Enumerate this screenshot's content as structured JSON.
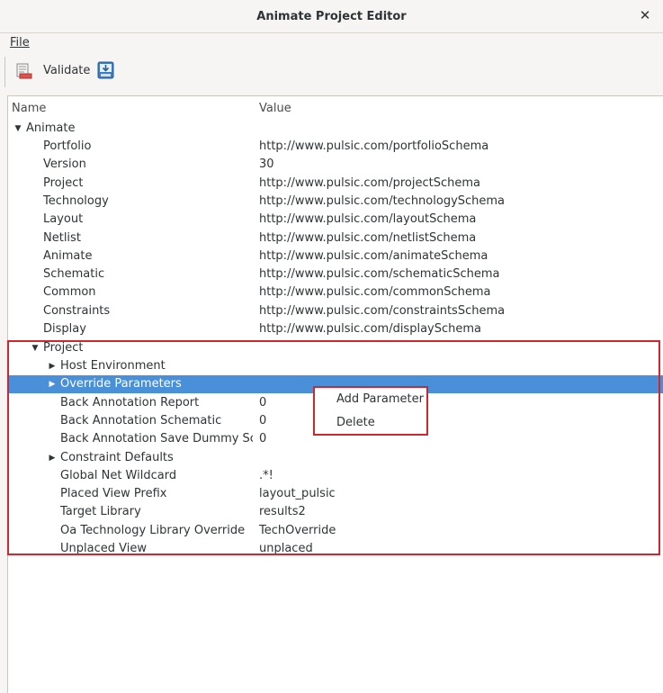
{
  "window": {
    "title": "Animate Project Editor"
  },
  "menubar": {
    "file_label": "File"
  },
  "toolbar": {
    "validate_label": "Validate"
  },
  "tree": {
    "columns": {
      "name": "Name",
      "value": "Value"
    },
    "root": "Animate",
    "schemas": [
      {
        "name": "Portfolio",
        "value": "http://www.pulsic.com/portfolioSchema"
      },
      {
        "name": "Version",
        "value": "30"
      },
      {
        "name": "Project",
        "value": "http://www.pulsic.com/projectSchema"
      },
      {
        "name": "Technology",
        "value": "http://www.pulsic.com/technologySchema"
      },
      {
        "name": "Layout",
        "value": "http://www.pulsic.com/layoutSchema"
      },
      {
        "name": "Netlist",
        "value": "http://www.pulsic.com/netlistSchema"
      },
      {
        "name": "Animate",
        "value": "http://www.pulsic.com/animateSchema"
      },
      {
        "name": "Schematic",
        "value": "http://www.pulsic.com/schematicSchema"
      },
      {
        "name": "Common",
        "value": "http://www.pulsic.com/commonSchema"
      },
      {
        "name": "Constraints",
        "value": "http://www.pulsic.com/constraintsSchema"
      },
      {
        "name": "Display",
        "value": "http://www.pulsic.com/displaySchema"
      }
    ],
    "project_label": "Project",
    "project_children": [
      {
        "name": "Host Environment",
        "value": "",
        "expander": true
      },
      {
        "name": "Override Parameters",
        "value": "",
        "expander": true,
        "selected": true
      },
      {
        "name": "Back Annotation Report",
        "value": "0"
      },
      {
        "name": "Back Annotation Schematic",
        "value": "0"
      },
      {
        "name": "Back Annotation Save Dummy Sch…",
        "value": "0"
      },
      {
        "name": "Constraint Defaults",
        "value": "",
        "expander": true
      },
      {
        "name": "Global Net Wildcard",
        "value": ".*!"
      },
      {
        "name": "Placed View Prefix",
        "value": "layout_pulsic"
      },
      {
        "name": "Target Library",
        "value": "results2"
      },
      {
        "name": "Oa Technology Library Override",
        "value": "TechOverride"
      },
      {
        "name": "Unplaced View",
        "value": "unplaced"
      }
    ]
  },
  "context_menu": {
    "add_parameter": "Add Parameter",
    "delete": "Delete"
  },
  "colors": {
    "selection": "#4a90d9",
    "highlight": "#d0262e"
  },
  "icons": {
    "close": "close-icon",
    "validate": "validate-icon",
    "download": "download-icon"
  }
}
